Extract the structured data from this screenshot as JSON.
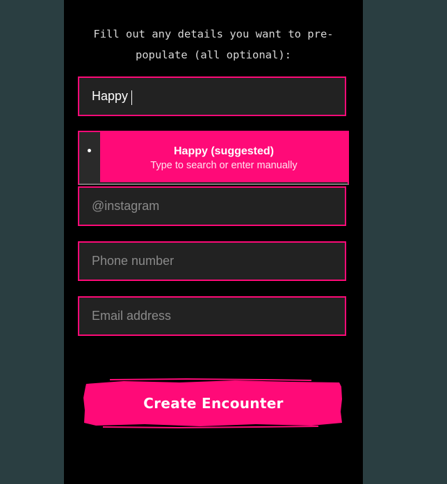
{
  "form": {
    "intro": "Fill out any details you want to pre-populate (all optional):",
    "name": {
      "value": "Happy",
      "placeholder": ""
    },
    "suggestion": {
      "title": "Happy (suggested)",
      "subtitle": "Type to search or enter manually"
    },
    "instagram": {
      "value": "",
      "placeholder": "@instagram"
    },
    "phone": {
      "value": "",
      "placeholder": "Phone number"
    },
    "email": {
      "value": "",
      "placeholder": "Email address"
    },
    "submit_label": "Create Encounter"
  },
  "colors": {
    "accent": "#ff0a78",
    "page_background": "#2a3e41",
    "panel_background": "#000000",
    "input_background": "#222222"
  }
}
